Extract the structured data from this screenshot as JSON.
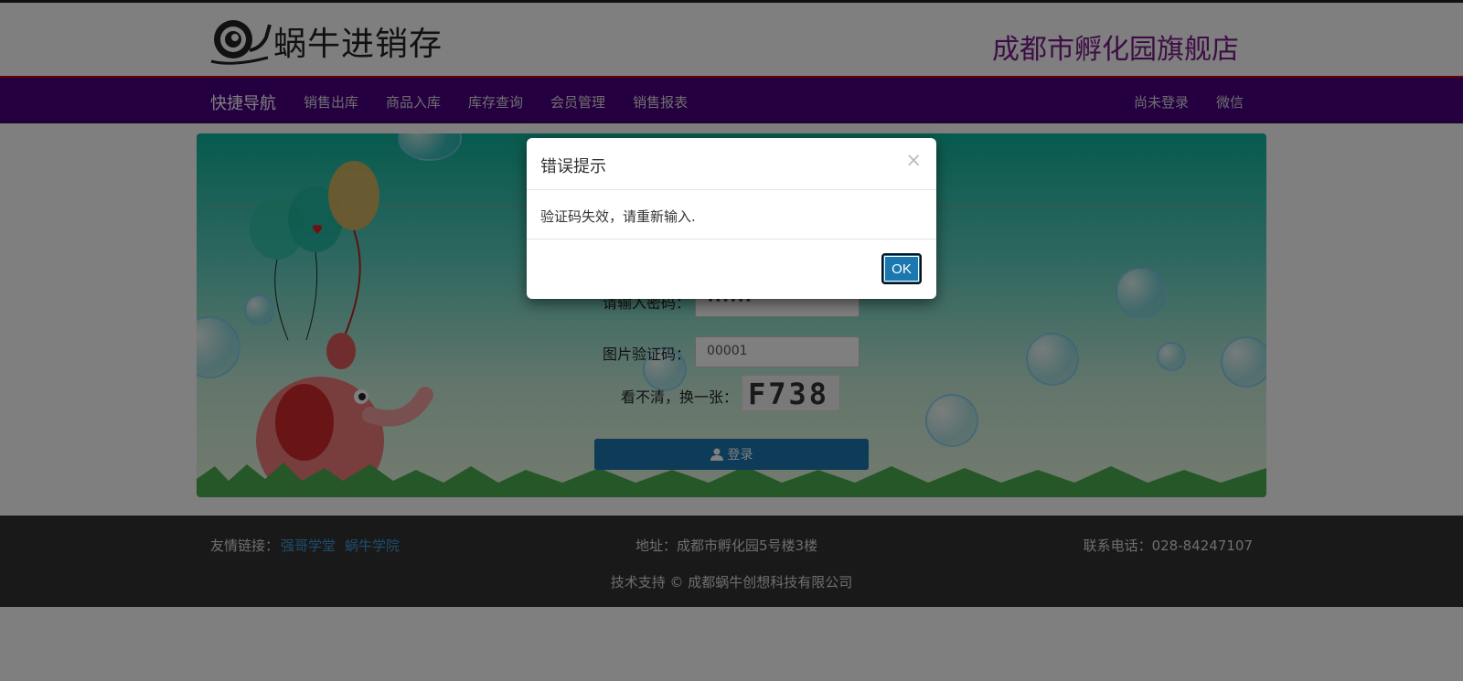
{
  "header": {
    "logo_text": "蜗牛进销存",
    "store_name": "成都市孵化园旗舰店"
  },
  "nav": {
    "brand": "快捷导航",
    "items": [
      "销售出库",
      "商品入库",
      "库存查询",
      "会员管理",
      "销售报表"
    ],
    "right": [
      "尚未登录",
      "微信"
    ]
  },
  "login": {
    "password_label": "请输入密码：",
    "password_value": "••••••",
    "captcha_label": "图片验证码：",
    "captcha_value": "00001",
    "refresh_label": "看不清，换一张：",
    "captcha_text": "F738",
    "submit_label": "登录"
  },
  "footer": {
    "links_label": "友情链接：",
    "links": [
      "强哥学堂",
      "蜗牛学院"
    ],
    "address": "地址：成都市孵化园5号楼3楼",
    "phone": "联系电话：028-84247107",
    "copyright": "技术支持 © 成都蜗牛创想科技有限公司"
  },
  "modal": {
    "title": "错误提示",
    "close_symbol": "×",
    "message": "验证码失效，请重新输入.",
    "ok_label": "OK"
  },
  "colors": {
    "navbar": "#4b0082",
    "store_name": "#7a1a8a",
    "button": "#1a77b0",
    "footer": "#333333"
  }
}
